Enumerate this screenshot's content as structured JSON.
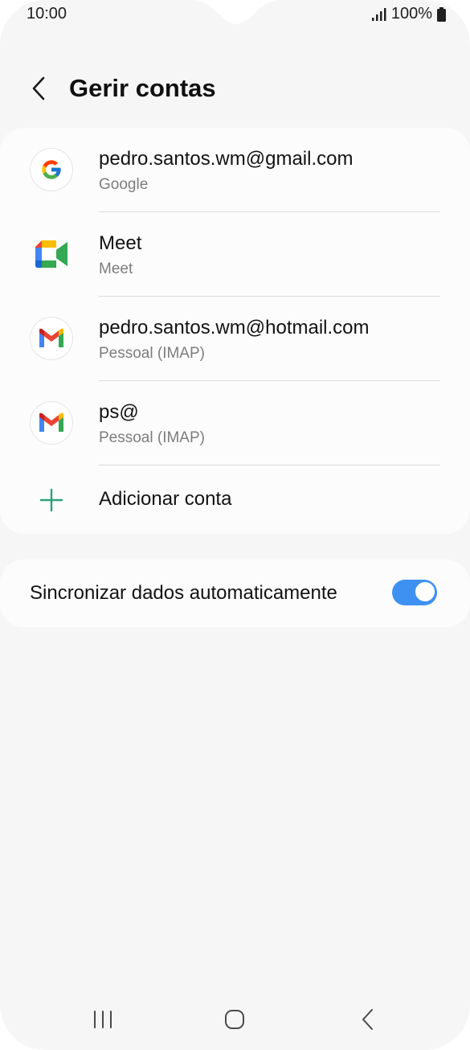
{
  "status_bar": {
    "time": "10:00",
    "battery": "100%"
  },
  "header": {
    "title": "Gerir contas"
  },
  "accounts": [
    {
      "title": "pedro.santos.wm@gmail.com",
      "subtitle": "Google",
      "icon": "google-icon"
    },
    {
      "title": "Meet",
      "subtitle": "Meet",
      "icon": "meet-icon"
    },
    {
      "title": "pedro.santos.wm@hotmail.com",
      "subtitle": "Pessoal (IMAP)",
      "icon": "gmail-icon"
    },
    {
      "title": "ps@",
      "subtitle": "Pessoal (IMAP)",
      "icon": "gmail-icon"
    }
  ],
  "add_account": {
    "label": "Adicionar conta",
    "icon": "plus-icon"
  },
  "sync": {
    "label": "Sincronizar dados automaticamente",
    "enabled": true
  },
  "colors": {
    "accent": "#3e91f0",
    "add_green": "#2aa17a",
    "background": "#f6f6f6",
    "card": "#fcfcfc"
  },
  "nav": {
    "recents": "recents-icon",
    "home": "home-icon",
    "back": "back-icon"
  }
}
